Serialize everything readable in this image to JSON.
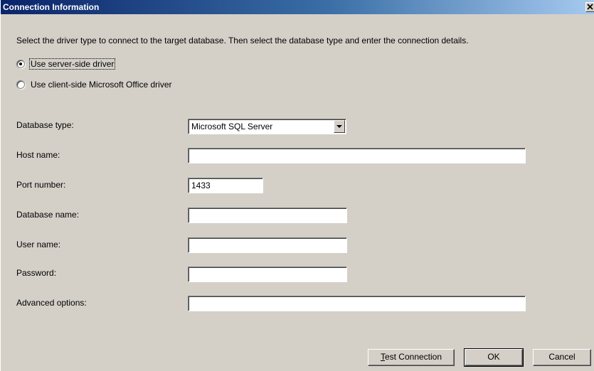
{
  "window": {
    "title": "Connection Information",
    "close_glyph": "✕"
  },
  "intro_text": "Select the driver type to connect to the target database. Then select the database type and enter the connection details.",
  "driver_options": [
    {
      "label": "Use server-side driver",
      "checked": true
    },
    {
      "label": "Use client-side Microsoft Office driver",
      "checked": false
    }
  ],
  "fields": {
    "database_type": {
      "label": "Database type:",
      "value": "Microsoft SQL Server"
    },
    "host_name": {
      "label": "Host name:",
      "value": ""
    },
    "port_number": {
      "label": "Port number:",
      "value": "1433"
    },
    "database_name": {
      "label": "Database name:",
      "value": ""
    },
    "user_name": {
      "label": "User name:",
      "value": ""
    },
    "password": {
      "label": "Password:",
      "value": ""
    },
    "advanced_options": {
      "label": "Advanced options:",
      "value": ""
    }
  },
  "buttons": {
    "test_connection_mnemonic": "T",
    "test_connection_rest": "est Connection",
    "ok": "OK",
    "cancel": "Cancel"
  },
  "icons": {
    "close": "close-icon",
    "dropdown": "chevron-down-icon"
  },
  "colors": {
    "title_bar_start": "#0a246a",
    "title_bar_end": "#a6caf0",
    "dialog_face": "#d4d0c8"
  }
}
